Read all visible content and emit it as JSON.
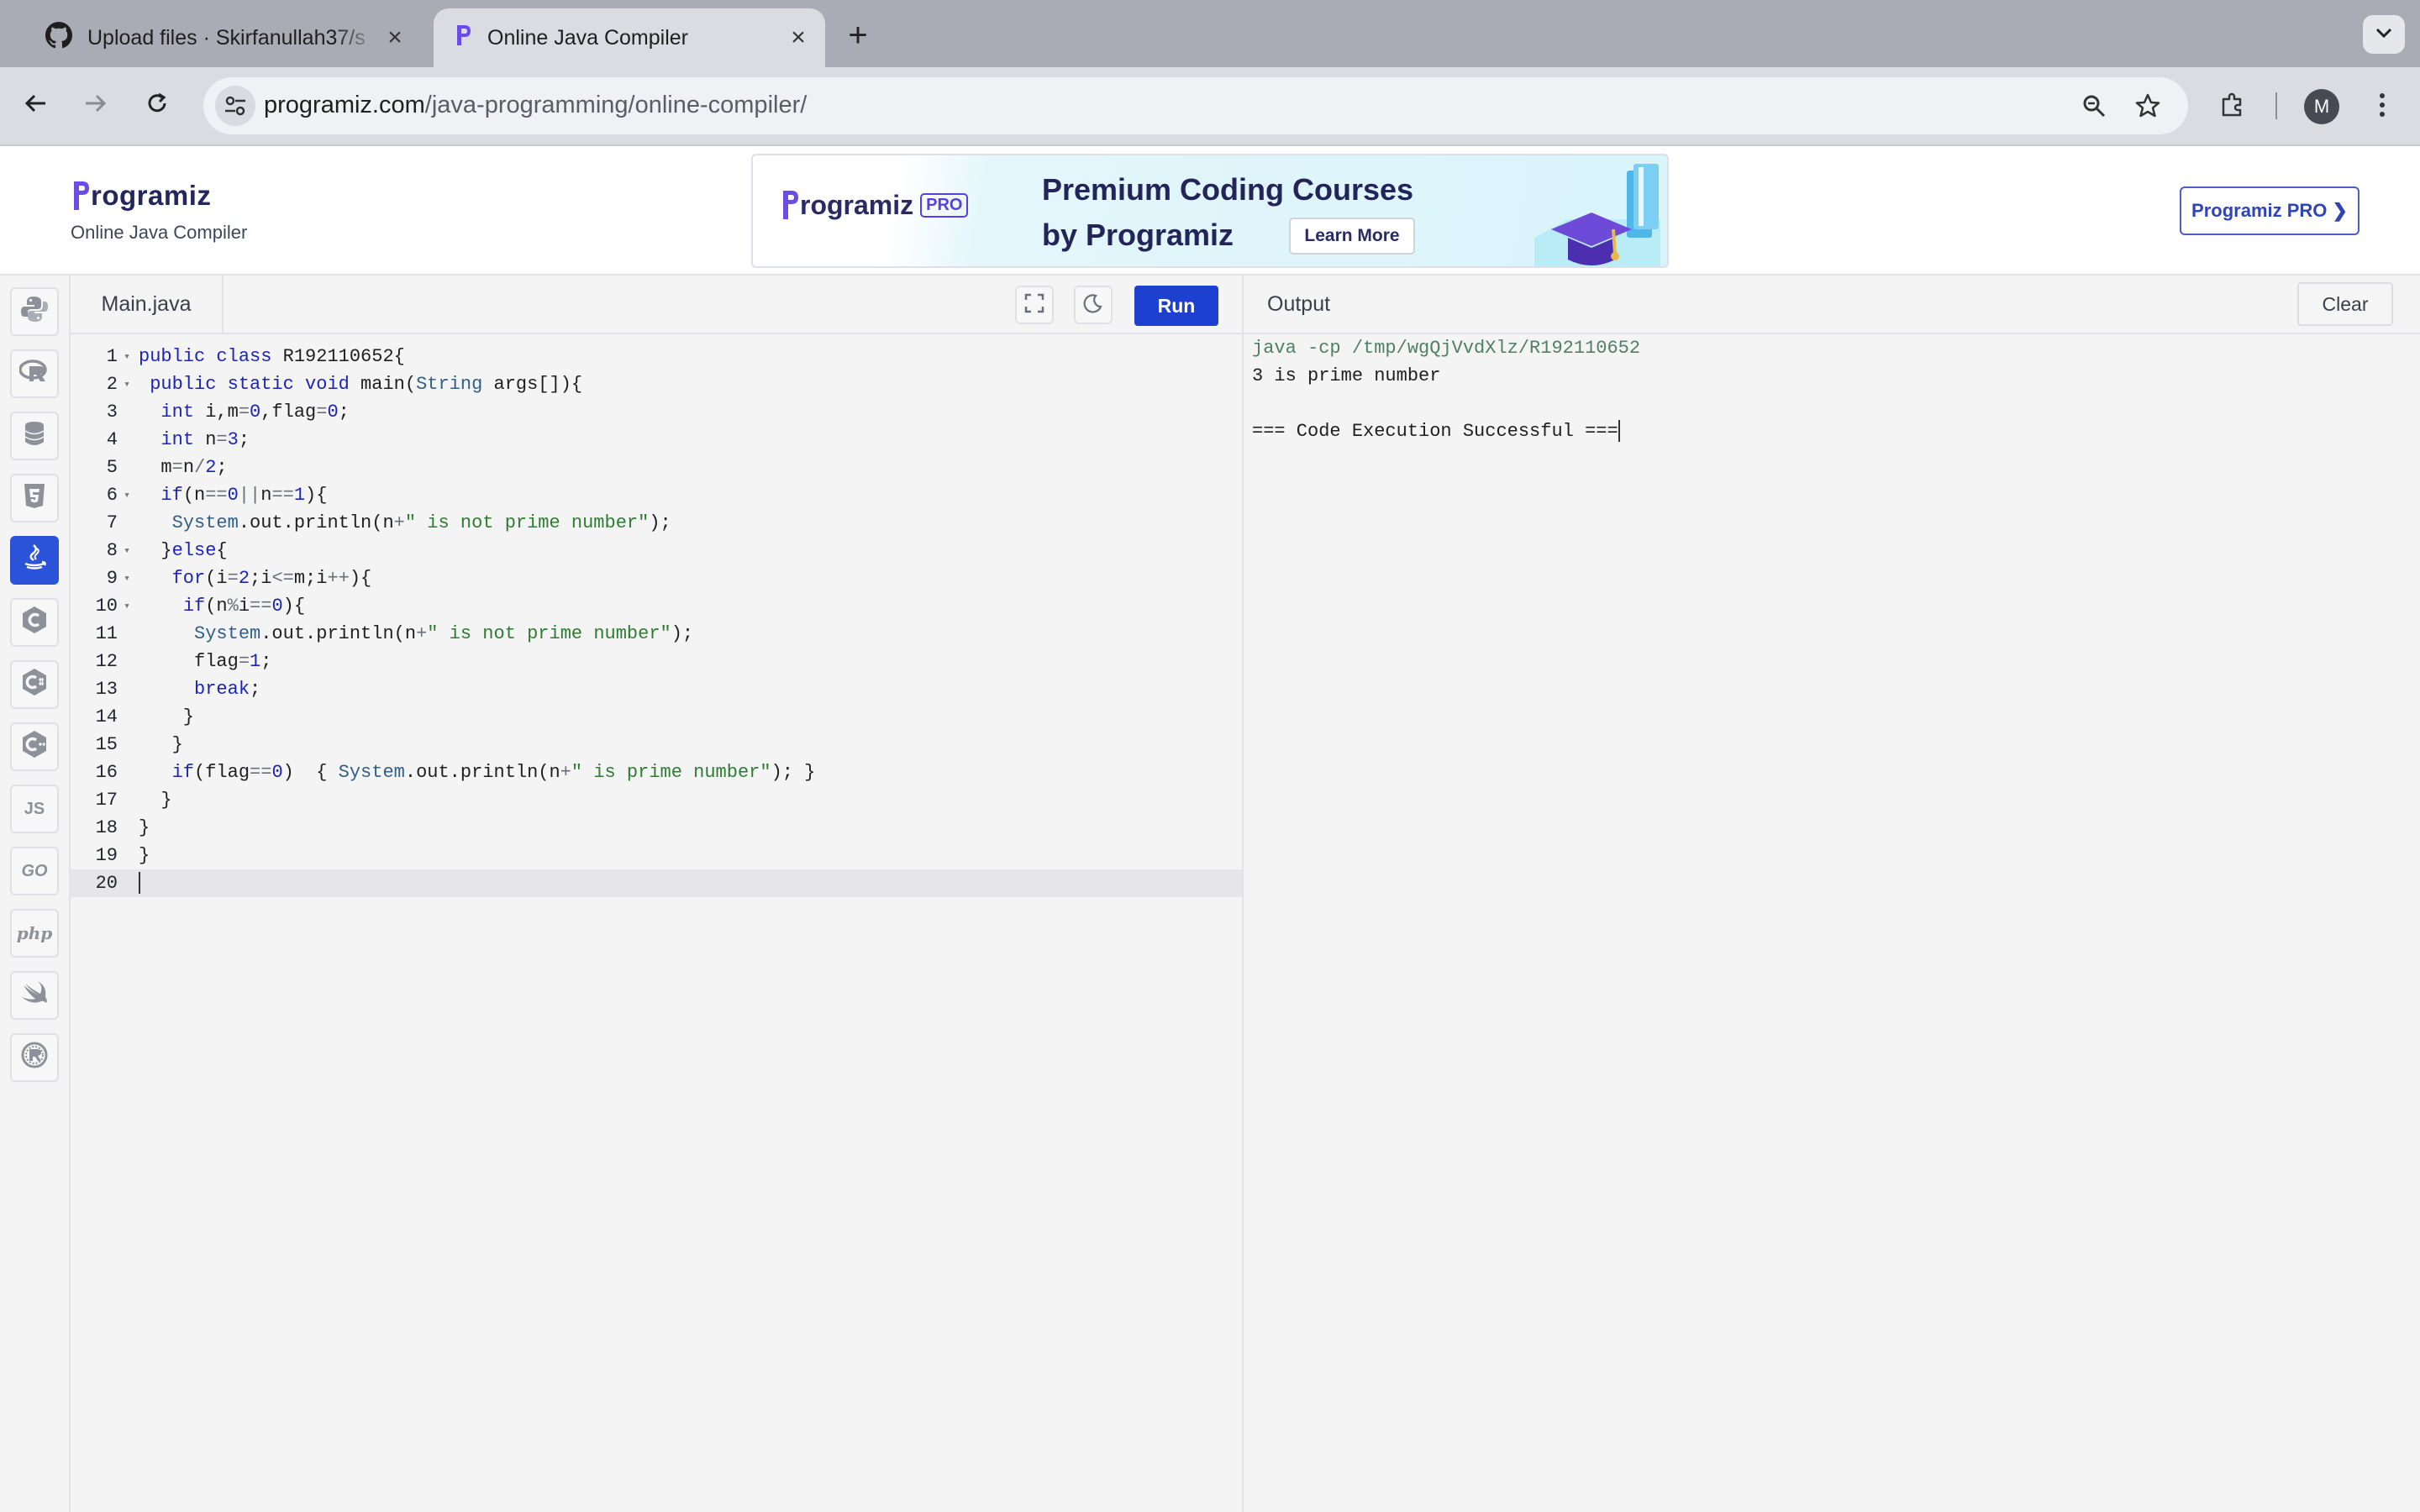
{
  "browser": {
    "tabs": [
      {
        "title": "Upload files · Skirfanullah37/s",
        "icon": "github-icon",
        "active": false
      },
      {
        "title": "Online Java Compiler",
        "icon": "programiz-favicon",
        "active": true
      }
    ],
    "url_domain": "programiz.com",
    "url_path": "/java-programming/online-compiler/",
    "profile_initial": "M"
  },
  "site": {
    "logo_text": "rogramiz",
    "subtitle": "Online Java Compiler",
    "ad": {
      "logo_text": "rogramiz",
      "logo_badge": "PRO",
      "headline_1": "Premium Coding Courses",
      "headline_2": "by Programiz",
      "cta": "Learn More"
    },
    "pro_button": "Programiz PRO ❯"
  },
  "sidebar": {
    "languages": [
      {
        "name": "python",
        "icon": "python-icon",
        "label": "",
        "active": false
      },
      {
        "name": "r",
        "icon": "r-icon",
        "label": "",
        "active": false
      },
      {
        "name": "sql",
        "icon": "database-icon",
        "label": "",
        "active": false
      },
      {
        "name": "html",
        "icon": "html5-icon",
        "label": "",
        "active": false
      },
      {
        "name": "java",
        "icon": "java-icon",
        "label": "",
        "active": true
      },
      {
        "name": "c",
        "icon": "c-icon",
        "label": "",
        "active": false
      },
      {
        "name": "csharp",
        "icon": "csharp-icon",
        "label": "",
        "active": false
      },
      {
        "name": "cpp",
        "icon": "cpp-icon",
        "label": "",
        "active": false
      },
      {
        "name": "javascript",
        "icon": "js-icon",
        "label": "JS",
        "active": false
      },
      {
        "name": "go",
        "icon": "go-icon",
        "label": "GO",
        "active": false
      },
      {
        "name": "php",
        "icon": "php-icon",
        "label": "php",
        "active": false
      },
      {
        "name": "swift",
        "icon": "swift-icon",
        "label": "",
        "active": false
      },
      {
        "name": "rust",
        "icon": "rust-icon",
        "label": "",
        "active": false
      }
    ]
  },
  "editor": {
    "file_name": "Main.java",
    "run_label": "Run",
    "lines": [
      {
        "n": "1",
        "fold": true,
        "code": "public class R192110652{"
      },
      {
        "n": "2",
        "fold": true,
        "code": " public static void main(String args[]){"
      },
      {
        "n": "3",
        "fold": false,
        "code": "  int i,m=0,flag=0;"
      },
      {
        "n": "4",
        "fold": false,
        "code": "  int n=3;"
      },
      {
        "n": "5",
        "fold": false,
        "code": "  m=n/2;"
      },
      {
        "n": "6",
        "fold": true,
        "code": "  if(n==0||n==1){"
      },
      {
        "n": "7",
        "fold": false,
        "code": "   System.out.println(n+\" is not prime number\");"
      },
      {
        "n": "8",
        "fold": true,
        "code": "  }else{"
      },
      {
        "n": "9",
        "fold": true,
        "code": "   for(i=2;i<=m;i++){"
      },
      {
        "n": "10",
        "fold": true,
        "code": "    if(n%i==0){"
      },
      {
        "n": "11",
        "fold": false,
        "code": "     System.out.println(n+\" is not prime number\");"
      },
      {
        "n": "12",
        "fold": false,
        "code": "     flag=1;"
      },
      {
        "n": "13",
        "fold": false,
        "code": "     break;"
      },
      {
        "n": "14",
        "fold": false,
        "code": "    }"
      },
      {
        "n": "15",
        "fold": false,
        "code": "   }"
      },
      {
        "n": "16",
        "fold": false,
        "code": "   if(flag==0)  { System.out.println(n+\" is prime number\"); }"
      },
      {
        "n": "17",
        "fold": false,
        "code": "  }"
      },
      {
        "n": "18",
        "fold": false,
        "code": "}"
      },
      {
        "n": "19",
        "fold": false,
        "code": "}"
      },
      {
        "n": "20",
        "fold": false,
        "code": ""
      }
    ],
    "current_line": "20"
  },
  "output": {
    "title": "Output",
    "clear_label": "Clear",
    "lines": [
      {
        "text": "java -cp /tmp/wgQjVvdXlz/R192110652",
        "kind": "cmd"
      },
      {
        "text": "3 is prime number",
        "kind": "out"
      },
      {
        "text": "",
        "kind": "out"
      },
      {
        "text": "=== Code Execution Successful ===",
        "kind": "out"
      }
    ]
  },
  "colors": {
    "accent": "#1e40d0",
    "active_language": "#2b53d9",
    "keyword": "#1c25b6",
    "string": "#2e7d32",
    "command_output": "#4f8066"
  }
}
